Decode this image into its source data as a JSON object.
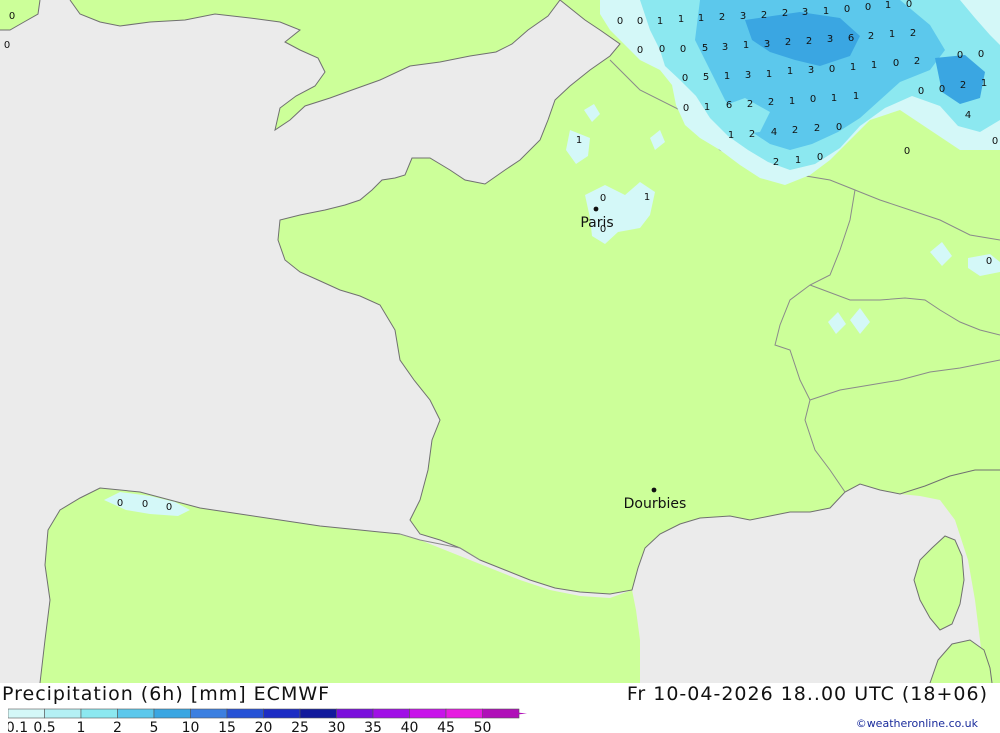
{
  "title": "Precipitation (6h) [mm] ECMWF",
  "datetime": "Fr 10-04-2026 18..00 UTC (18+06)",
  "credit": "©weatheronline.co.uk",
  "colors": {
    "sea": "#ebebeb",
    "land": "#ccff99",
    "border": "#8a8a8a",
    "coast": "#707070",
    "precip_light": "#d4f8f8",
    "precip_mid": "#8ce8f0",
    "precip_strong": "#5cc8ec",
    "precip_heavy": "#3aa6e2"
  },
  "places": [
    {
      "name": "Paris"
    },
    {
      "name": "Dourbies"
    }
  ],
  "legend": {
    "ticks": [
      "0.1",
      "0.5",
      "1",
      "2",
      "5",
      "10",
      "15",
      "20",
      "25",
      "30",
      "35",
      "40",
      "45",
      "50"
    ],
    "colors": [
      "#d4f8f8",
      "#b4f0f4",
      "#8ce8f0",
      "#5cc8ec",
      "#3aa6e2",
      "#3c7fe0",
      "#2652d6",
      "#1c2cc4",
      "#121a9c",
      "#7a10dc",
      "#a010e6",
      "#c814ea",
      "#e61ce0",
      "#b010b8"
    ]
  },
  "values": [
    "0",
    "0",
    "0",
    "0",
    "1",
    "1",
    "1",
    "2",
    "3",
    "2",
    "2",
    "3",
    "1",
    "0",
    "0",
    "1",
    "0",
    "0",
    "0",
    "0",
    "5",
    "3",
    "1",
    "3",
    "2",
    "2",
    "3",
    "6",
    "2",
    "1",
    "2",
    "0",
    "0",
    "0",
    "5",
    "1",
    "3",
    "1",
    "1",
    "3",
    "0",
    "1",
    "1",
    "0",
    "2",
    "0",
    "0",
    "2",
    "1",
    "0",
    "1",
    "6",
    "2",
    "2",
    "1",
    "0",
    "1",
    "1",
    "1",
    "2",
    "4",
    "2",
    "2",
    "0",
    "4",
    "2",
    "1",
    "0",
    "0",
    "0",
    "1",
    "0",
    "1",
    "0",
    "0",
    "0",
    "0",
    "0",
    "0",
    "1"
  ]
}
